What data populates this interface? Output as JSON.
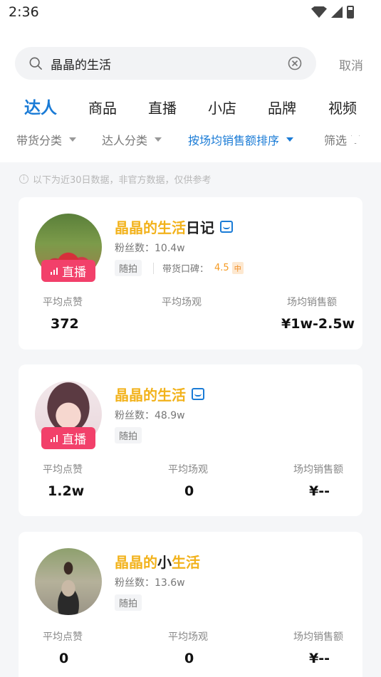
{
  "status_bar": {
    "time": "2:36",
    "icons": [
      "wifi-icon",
      "signal-icon",
      "battery-icon"
    ]
  },
  "search": {
    "value": "晶晶的生活",
    "cancel_label": "取消"
  },
  "tabs": [
    {
      "label": "达人",
      "active": true
    },
    {
      "label": "商品",
      "active": false
    },
    {
      "label": "直播",
      "active": false
    },
    {
      "label": "小店",
      "active": false
    },
    {
      "label": "品牌",
      "active": false
    },
    {
      "label": "视频",
      "active": false
    }
  ],
  "filters": [
    {
      "label": "带货分类",
      "active": false
    },
    {
      "label": "达人分类",
      "active": false
    },
    {
      "label": "按场均销售额排序",
      "active": true
    },
    {
      "label": "筛选",
      "active": false
    }
  ],
  "notice": "以下为近30日数据，非官方数据，仅供参考",
  "colors": {
    "accent": "#1a7bd6",
    "highlight": "#f2b21b",
    "live": "#f2406a"
  },
  "cards": [
    {
      "name_parts": [
        {
          "text": "晶晶的生活",
          "highlight": true
        },
        {
          "text": "日记",
          "highlight": false
        }
      ],
      "fans": "粉丝数：10.4w",
      "tag": "随拍",
      "reputation_label": "带货口碑：",
      "reputation_value": "4.5",
      "reputation_level": "中",
      "live": true,
      "live_label": "直播",
      "stats": [
        {
          "label": "平均点赞",
          "value": "372"
        },
        {
          "label": "平均场观",
          "value": ""
        },
        {
          "label": "场均销售额",
          "value": "¥1w-2.5w"
        }
      ]
    },
    {
      "name_parts": [
        {
          "text": "晶晶的生活",
          "highlight": true
        }
      ],
      "fans": "粉丝数：48.9w",
      "tag": "随拍",
      "live": true,
      "live_label": "直播",
      "stats": [
        {
          "label": "平均点赞",
          "value": "1.2w"
        },
        {
          "label": "平均场观",
          "value": "0"
        },
        {
          "label": "场均销售额",
          "value": "¥--"
        }
      ]
    },
    {
      "name_parts": [
        {
          "text": "晶晶的",
          "highlight": true
        },
        {
          "text": "小",
          "highlight": false
        },
        {
          "text": "生活",
          "highlight": true
        }
      ],
      "fans": "粉丝数：13.6w",
      "tag": "随拍",
      "live": false,
      "stats": [
        {
          "label": "平均点赞",
          "value": "0"
        },
        {
          "label": "平均场观",
          "value": "0"
        },
        {
          "label": "场均销售额",
          "value": "¥--"
        }
      ]
    }
  ]
}
